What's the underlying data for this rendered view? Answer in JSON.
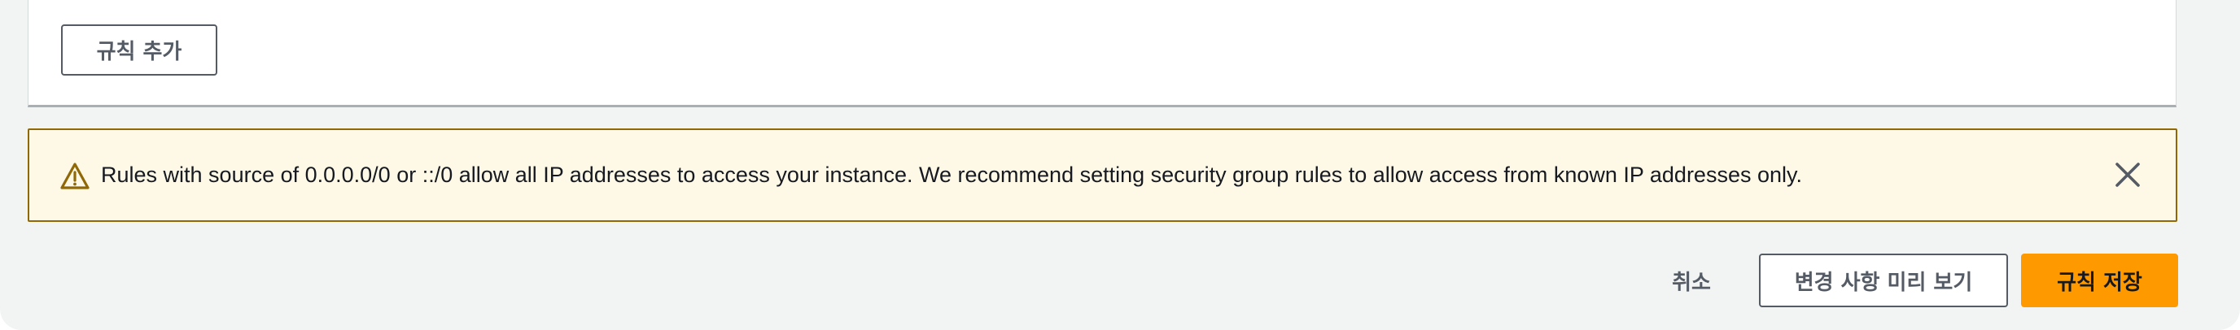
{
  "rules": {
    "add_rule_label": "규칙 추가"
  },
  "warning": {
    "message": "Rules with source of 0.0.0.0/0 or ::/0 allow all IP addresses to access your instance. We recommend setting security group rules to allow access from known IP addresses only.",
    "icon": "warning-triangle-icon",
    "close_icon": "close-icon",
    "color": "#906806",
    "background": "#fef9e7"
  },
  "footer": {
    "cancel_label": "취소",
    "preview_label": "변경 사항 미리 보기",
    "save_label": "규칙 저장",
    "save_color": "#ff9900"
  }
}
